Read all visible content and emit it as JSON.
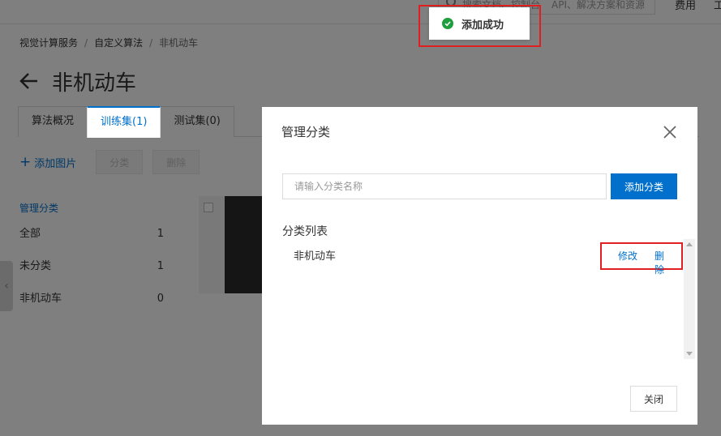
{
  "topbar": {
    "search_hint_left": "搜索文档、控制台",
    "search_hint_right": "API、解决方案和资源",
    "fee_link": "费用",
    "right_edge": "工"
  },
  "breadcrumb": [
    "视觉计算服务",
    "自定义算法",
    "非机动车"
  ],
  "page": {
    "title": "非机动车"
  },
  "tabs": [
    {
      "label": "算法概况"
    },
    {
      "label": "训练集(1)"
    },
    {
      "label": "测试集(0)"
    }
  ],
  "toolbar": {
    "add_image": "添加图片",
    "classify": "分类",
    "delete": "删除"
  },
  "sidebar": {
    "header": "管理分类",
    "items": [
      {
        "label": "全部",
        "count": "1"
      },
      {
        "label": "未分类",
        "count": "1"
      },
      {
        "label": "非机动车",
        "count": "0"
      }
    ]
  },
  "toast": {
    "message": "添加成功",
    "status_color": "#1e9e3c"
  },
  "dialog": {
    "title": "管理分类",
    "input_placeholder": "请输入分类名称",
    "add_button": "添加分类",
    "list_title": "分类列表",
    "rows": [
      {
        "name": "非机动车",
        "edit": "修改",
        "delete": "删除"
      }
    ],
    "close_button": "关闭"
  },
  "colors": {
    "accent": "#0070cc",
    "highlight_box": "#e02020"
  }
}
